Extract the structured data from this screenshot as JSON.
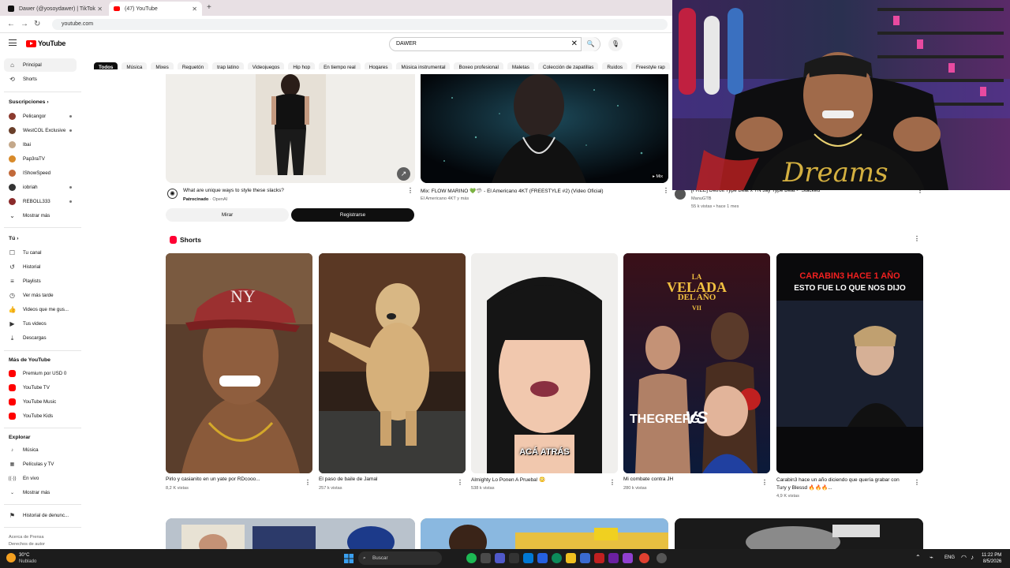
{
  "browser": {
    "tabs": [
      {
        "title": "Dawer (@yosoydawer) | TikTok",
        "active": false
      },
      {
        "title": "(47) YouTube",
        "active": true
      }
    ],
    "new_tab": "+",
    "url": "youtube.com"
  },
  "header": {
    "logo_text": "YouTube",
    "search_value": "DAWER"
  },
  "chips": [
    "Todos",
    "Música",
    "Mixes",
    "Reguetón",
    "trap latino",
    "Videojuegos",
    "Hip hop",
    "En tiempo real",
    "Hogares",
    "Música instrumental",
    "Boxeo profesional",
    "Maletas",
    "Colección de zapatillas",
    "Ruidos",
    "Freestyle rap"
  ],
  "sidebar": {
    "main": [
      {
        "label": "Principal",
        "icon": "home-icon",
        "active": true
      },
      {
        "label": "Shorts",
        "icon": "shorts-icon",
        "active": false
      }
    ],
    "subs_heading": "Suscripciones  ›",
    "subscriptions": [
      {
        "label": "Pelicangor",
        "color": "#8b3a2e"
      },
      {
        "label": "WestCOL Exclusive",
        "color": "#6a3f2a"
      },
      {
        "label": "Ibai",
        "color": "#c4a88a"
      },
      {
        "label": "Pap3raTV",
        "color": "#d88a2a"
      },
      {
        "label": "IShowSpeed",
        "color": "#c26a3a"
      },
      {
        "label": "iobriah",
        "color": "#333333"
      },
      {
        "label": "REBOLL333",
        "color": "#8a2a2a"
      }
    ],
    "show_more_1": "Mostrar más",
    "you_heading": "Tú  ›",
    "you": [
      {
        "label": "Tu canal",
        "icon": "channel-icon"
      },
      {
        "label": "Historial",
        "icon": "history-icon"
      },
      {
        "label": "Playlists",
        "icon": "playlists-icon"
      },
      {
        "label": "Ver más tarde",
        "icon": "watch-later-icon"
      },
      {
        "label": "Videos que me gus...",
        "icon": "liked-icon"
      },
      {
        "label": "Tus videos",
        "icon": "your-videos-icon"
      },
      {
        "label": "Descargas",
        "icon": "downloads-icon"
      }
    ],
    "more_heading": "Más de YouTube",
    "more": [
      {
        "label": "Premium por USD 0"
      },
      {
        "label": "YouTube TV"
      },
      {
        "label": "YouTube Music"
      },
      {
        "label": "YouTube Kids"
      }
    ],
    "explore_heading": "Explorar",
    "explore": [
      {
        "label": "Música",
        "icon": "music-icon"
      },
      {
        "label": "Películas y TV",
        "icon": "movies-icon"
      },
      {
        "label": "En vivo",
        "icon": "live-icon"
      },
      {
        "label": "Mostrar más",
        "icon": "chevron-down-icon"
      }
    ],
    "report": "Historial de denunc...",
    "footer": [
      "Acerca de   Prensa",
      "Derechos de autor"
    ]
  },
  "ad": {
    "title": "What are unique ways to style these slacks?",
    "sponsor": "Patrocinado",
    "advertiser": "OpenAI",
    "btn_left": "Mirar",
    "btn_right": "Registrarse"
  },
  "videos": [
    {
      "title": "Mix: FLOW MARINO 💚🦈 - El Americano 4KT  (FREESTYLE #2) (Video Oficial)",
      "meta": "El Americano 4KT y más",
      "badge": "▸ Mix"
    },
    {
      "title": "[FREE] Detroit Type Beat x YN Jay Type Beat - \"Stacked\"",
      "channel": "ManuGTB",
      "meta": "55 k vistas • hace 1 mes"
    }
  ],
  "shorts": {
    "heading": "Shorts",
    "items": [
      {
        "title": "Pirlo y casianito en un yate por RDcooo...",
        "views": "8,2 K vistas"
      },
      {
        "title": "El paso de baile de Jamal",
        "views": "257 k vistas"
      },
      {
        "title": "Almighty Lo Ponen A Prueba! 😳",
        "views": "538 k vistas",
        "caption": "ACÁ ATRÁS"
      },
      {
        "title": "Mi combate contra JH",
        "views": "280 k vistas",
        "poster": [
          "LA",
          "VELADA",
          "DEL AÑO",
          "VII",
          "THEGREFG",
          "VS"
        ]
      },
      {
        "title": "Carabin3 hace un año diciendo que quería grabar con Tury y Blessd 🔥🔥🔥...",
        "views": "4,9 K vistas",
        "headline1": "CARABIN3 HACE 1 AÑO",
        "headline2": "ESTO FUE LO QUE NOS DIJO"
      }
    ]
  },
  "taskbar": {
    "temp": "30°C",
    "weather": "Nublado",
    "search": "Buscar",
    "lang": "ENG",
    "time": "11:22 PM",
    "date": "8/5/2026"
  }
}
